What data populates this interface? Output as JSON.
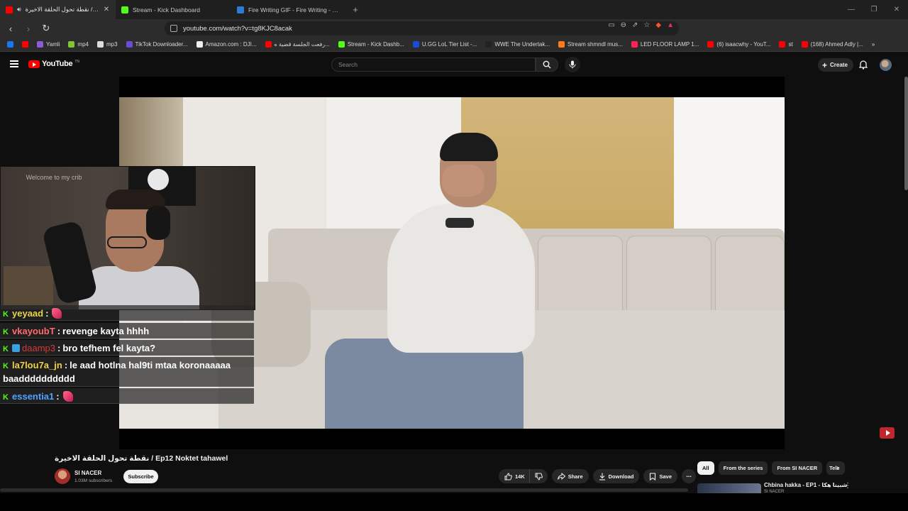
{
  "browser": {
    "tabs": [
      {
        "title": "نقطة تحول الحلقة الاخيرة / ...be",
        "favicon_color": "#ff0000",
        "active": true
      },
      {
        "title": "Stream - Kick Dashboard",
        "favicon_color": "#53fc18",
        "active": false
      },
      {
        "title": "Fire Writing GIF - Fire Writing - Disco",
        "favicon_color": "#2f7bd8",
        "active": false
      }
    ],
    "url": "youtube.com/watch?v=tg8KJC8acak",
    "bookmarks": [
      {
        "label": "",
        "color": "#1877f2"
      },
      {
        "label": "",
        "color": "#ff0000"
      },
      {
        "label": "Yamli",
        "color": "#8a5cd6"
      },
      {
        "label": "mp4",
        "color": "#7ec531"
      },
      {
        "label": "mp3",
        "color": "#dddddd"
      },
      {
        "label": "TikTok Downloader...",
        "color": "#6b4bd6"
      },
      {
        "label": "Amazon.com : DJI...",
        "color": "#f0f0f0"
      },
      {
        "label": "رفعت الجلسة قضية ه...",
        "color": "#ff0000"
      },
      {
        "label": "Stream - Kick Dashb...",
        "color": "#53fc18"
      },
      {
        "label": "U.GG LoL Tier List -...",
        "color": "#1b4cd6"
      },
      {
        "label": "WWE The Undertak...",
        "color": "#222222"
      },
      {
        "label": "Stream shmndl mus...",
        "color": "#ff7a1a"
      },
      {
        "label": "LED FLOOR LAMP 1...",
        "color": "#ff2255"
      },
      {
        "label": "(6) isaacwhy - YouT...",
        "color": "#ff0000"
      },
      {
        "label": "st",
        "color": "#ff0000"
      },
      {
        "label": "(168) Ahmed Adly |...",
        "color": "#ff0000"
      }
    ]
  },
  "youtube": {
    "logo_text": "YouTube",
    "logo_sup": "TN",
    "search_placeholder": "Search",
    "create_label": "Create",
    "video": {
      "title": "نقطة تحول الحلقة الاخيرة / Ep12 Noktet tahawel",
      "channel": "SI NACER",
      "subscribers": "1.03M subscribers",
      "subscribe_label": "Subscribe",
      "likes": "14K",
      "share_label": "Share",
      "download_label": "Download",
      "save_label": "Save"
    },
    "chips": [
      "All",
      "From the series",
      "From SI NACER",
      "Tele"
    ],
    "recommendation": {
      "title": "Chbina hakka - EP1 - شبينا هكا",
      "channel": "SI NACER"
    }
  },
  "stream_overlay": {
    "webcam_sign": "Welcome to my crib",
    "chat": [
      {
        "user": "yeyaad",
        "user_color": "#e8d34a",
        "message": "",
        "sticker": true
      },
      {
        "user": "vkayoubT",
        "user_color": "#ff6b6b",
        "message": "revenge kayta hhhh",
        "sticker": false
      },
      {
        "user": "daamp3",
        "user_color": "#d63a3a",
        "message": "bro tefhem fel kayta?",
        "sticker": false
      },
      {
        "user": "la7lou7a_jn",
        "user_color": "#f0d24a",
        "message": "le aad hotlna hal9ti mtaa koronaaaaa baadddddddddd",
        "sticker": false
      },
      {
        "user": "essentia1",
        "user_color": "#4fa3ff",
        "message": "",
        "sticker": true
      }
    ]
  }
}
